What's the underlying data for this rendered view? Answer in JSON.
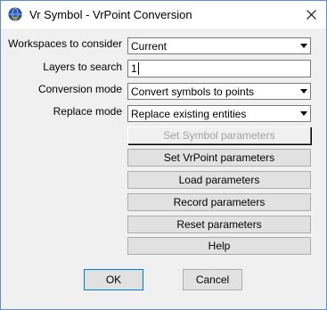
{
  "window": {
    "title": "Vr Symbol - VrPoint Conversion"
  },
  "form": {
    "workspaces": {
      "label": "Workspaces to consider",
      "value": "Current"
    },
    "layers": {
      "label": "Layers to search",
      "value": "1"
    },
    "conversion_mode": {
      "label": "Conversion mode",
      "value": "Convert symbols to points"
    },
    "replace_mode": {
      "label": "Replace mode",
      "value": "Replace existing entities"
    }
  },
  "buttons": {
    "set_symbol": "Set Symbol parameters",
    "set_vrpoint": "Set VrPoint parameters",
    "load": "Load parameters",
    "record": "Record parameters",
    "reset": "Reset parameters",
    "help": "Help",
    "ok": "OK",
    "cancel": "Cancel"
  },
  "icons": {
    "app": "globe-app-icon",
    "close": "close-icon",
    "dropdown": "chevron-down-icon"
  },
  "colors": {
    "window_border": "#5a8fd6",
    "dialog_bg": "#f0f0f0",
    "disabled_text": "#a0a0a0",
    "default_button_border": "#0078d7"
  }
}
